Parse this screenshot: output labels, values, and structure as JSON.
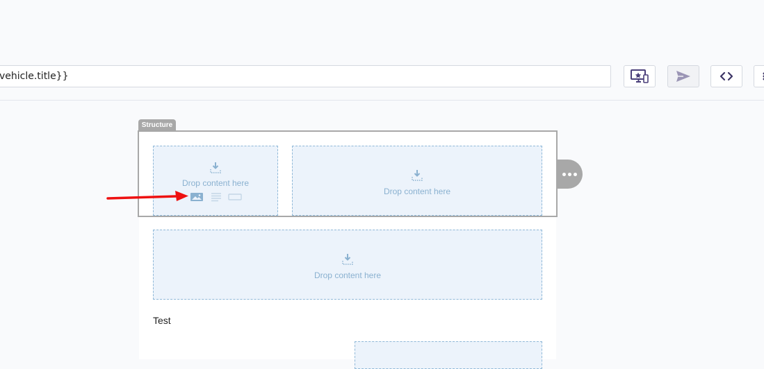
{
  "header": {
    "subject_value": "vehicle.title}}",
    "buttons": {
      "preview": "preview-icon",
      "send": "send-icon",
      "code": "code-icon"
    }
  },
  "editor": {
    "structure_tag": "Structure",
    "drop_zones": [
      {
        "label": "Drop content here"
      },
      {
        "label": "Drop content here"
      },
      {
        "label": "Drop content here"
      },
      {
        "label": ""
      }
    ],
    "content_tools": [
      "image-icon",
      "text-icon",
      "button-icon"
    ],
    "text_block": "Test"
  },
  "colors": {
    "accent": "#4a3f7a",
    "drop_bg": "#ecf3fb",
    "drop_border": "#8fb8d8",
    "structure_gray": "#a8a8a8",
    "annotation_arrow": "#ee1111"
  }
}
